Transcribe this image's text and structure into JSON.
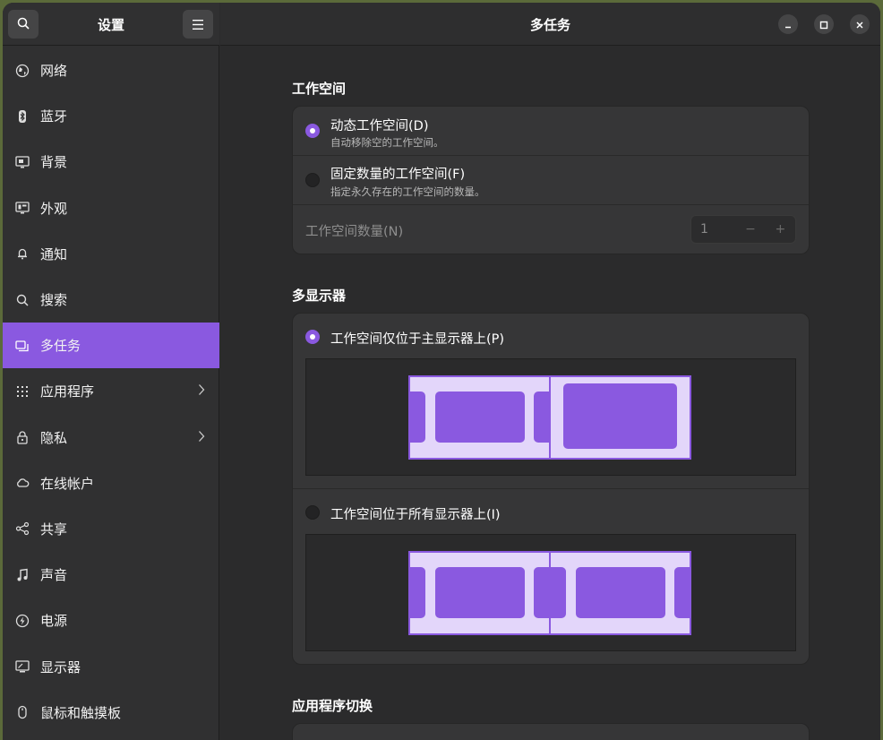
{
  "sidebar": {
    "title": "设置",
    "items": [
      {
        "label": "网络",
        "icon": "network-globe-icon"
      },
      {
        "label": "蓝牙",
        "icon": "bluetooth-icon"
      },
      {
        "label": "背景",
        "icon": "background-display-icon"
      },
      {
        "label": "外观",
        "icon": "appearance-display-icon"
      },
      {
        "label": "通知",
        "icon": "bell-icon"
      },
      {
        "label": "搜索",
        "icon": "search-icon"
      },
      {
        "label": "多任务",
        "icon": "multitasking-icon",
        "active": true
      },
      {
        "label": "应用程序",
        "icon": "apps-grid-icon",
        "chevron": true
      },
      {
        "label": "隐私",
        "icon": "lock-icon",
        "chevron": true
      },
      {
        "label": "在线帐户",
        "icon": "cloud-icon"
      },
      {
        "label": "共享",
        "icon": "share-icon"
      },
      {
        "label": "声音",
        "icon": "music-note-icon"
      },
      {
        "label": "电源",
        "icon": "power-icon"
      },
      {
        "label": "显示器",
        "icon": "display-icon"
      },
      {
        "label": "鼠标和触摸板",
        "icon": "mouse-icon"
      }
    ]
  },
  "main": {
    "title": "多任务",
    "workspaces": {
      "title": "工作空间",
      "dynamic": {
        "label": "动态工作空间(D)",
        "sub": "自动移除空的工作空间。",
        "selected": true
      },
      "fixed": {
        "label": "固定数量的工作空间(F)",
        "sub": "指定永久存在的工作空间的数量。",
        "selected": false
      },
      "count": {
        "label": "工作空间数量(N)",
        "value": "1",
        "minus": "−",
        "plus": "+"
      }
    },
    "multimonitor": {
      "title": "多显示器",
      "primary_only": {
        "label": "工作空间仅位于主显示器上(P)",
        "selected": true
      },
      "all_displays": {
        "label": "工作空间位于所有显示器上(I)",
        "selected": false
      }
    },
    "app_switching": {
      "title": "应用程序切换"
    }
  },
  "colors": {
    "accent": "#8a59e0",
    "window_bg": "#2b2b2c",
    "sidebar_bg": "#303031",
    "card_bg": "#363637"
  }
}
